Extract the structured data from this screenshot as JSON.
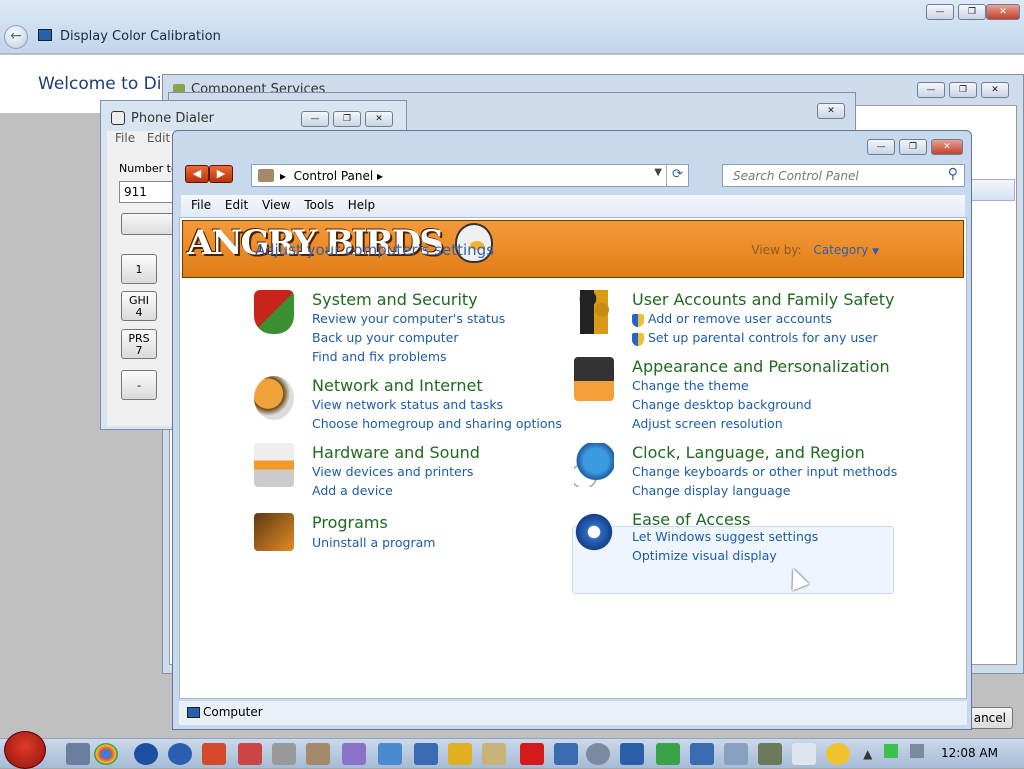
{
  "background_window": {
    "title": "Display Color Calibration",
    "welcome": "Welcome to Disp"
  },
  "component_services": {
    "title": "Component Services",
    "cancel": "ancel"
  },
  "phone_dialer": {
    "title": "Phone Dialer",
    "menu": [
      "File",
      "Edit"
    ],
    "number_label": "Number to d",
    "number_value": "911",
    "keys": [
      "1",
      "GHI\n4",
      "PRS\n7",
      "-"
    ]
  },
  "control_panel": {
    "breadcrumb": "Control Panel",
    "search_placeholder": "Search Control Panel",
    "menu": [
      "File",
      "Edit",
      "View",
      "Tools",
      "Help"
    ],
    "banner_text": "ANGRY BIRDS",
    "heading": "Adjust your computer's settings",
    "view_by_label": "View by:",
    "view_by_value": "Category",
    "categories": [
      {
        "title": "System and Security",
        "links": [
          "Review your computer's status",
          "Back up your computer",
          "Find and fix problems"
        ]
      },
      {
        "title": "Network and Internet",
        "links": [
          "View network status and tasks",
          "Choose homegroup and sharing options"
        ]
      },
      {
        "title": "Hardware and Sound",
        "links": [
          "View devices and printers",
          "Add a device"
        ]
      },
      {
        "title": "Programs",
        "links": [
          "Uninstall a program"
        ]
      },
      {
        "title": "User Accounts and Family Safety",
        "links": [
          "Add or remove user accounts",
          "Set up parental controls for any user"
        ]
      },
      {
        "title": "Appearance and Personalization",
        "links": [
          "Change the theme",
          "Change desktop background",
          "Adjust screen resolution"
        ]
      },
      {
        "title": "Clock, Language, and Region",
        "links": [
          "Change keyboards or other input methods",
          "Change display language"
        ]
      },
      {
        "title": "Ease of Access",
        "links": [
          "Let Windows suggest settings",
          "Optimize visual display"
        ]
      }
    ],
    "status_text": "Computer"
  },
  "taskbar": {
    "time": "12:08 AM"
  },
  "colors": {
    "accent_link": "#1c5ca8",
    "category_title": "#1e6a1e",
    "banner": "#e17d16"
  }
}
